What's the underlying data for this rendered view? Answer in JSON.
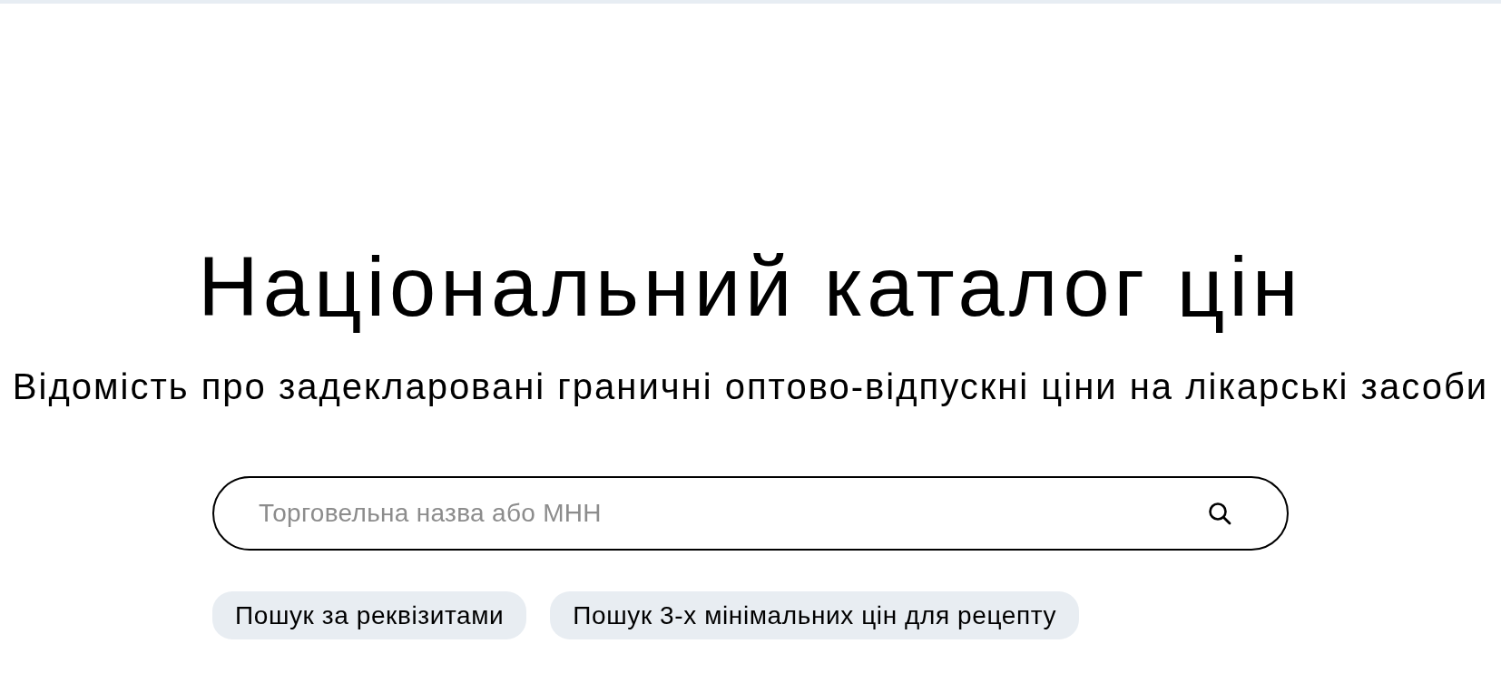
{
  "title": "Національний каталог цін",
  "subtitle": "Відомість про задекларовані граничні оптово-відпускні ціни на лікарські засоби",
  "search": {
    "placeholder": "Торговельна назва або МНН"
  },
  "quick_links": [
    {
      "label": "Пошук за реквізитами"
    },
    {
      "label": "Пошук 3-х мінімальних цін для рецепту"
    }
  ]
}
